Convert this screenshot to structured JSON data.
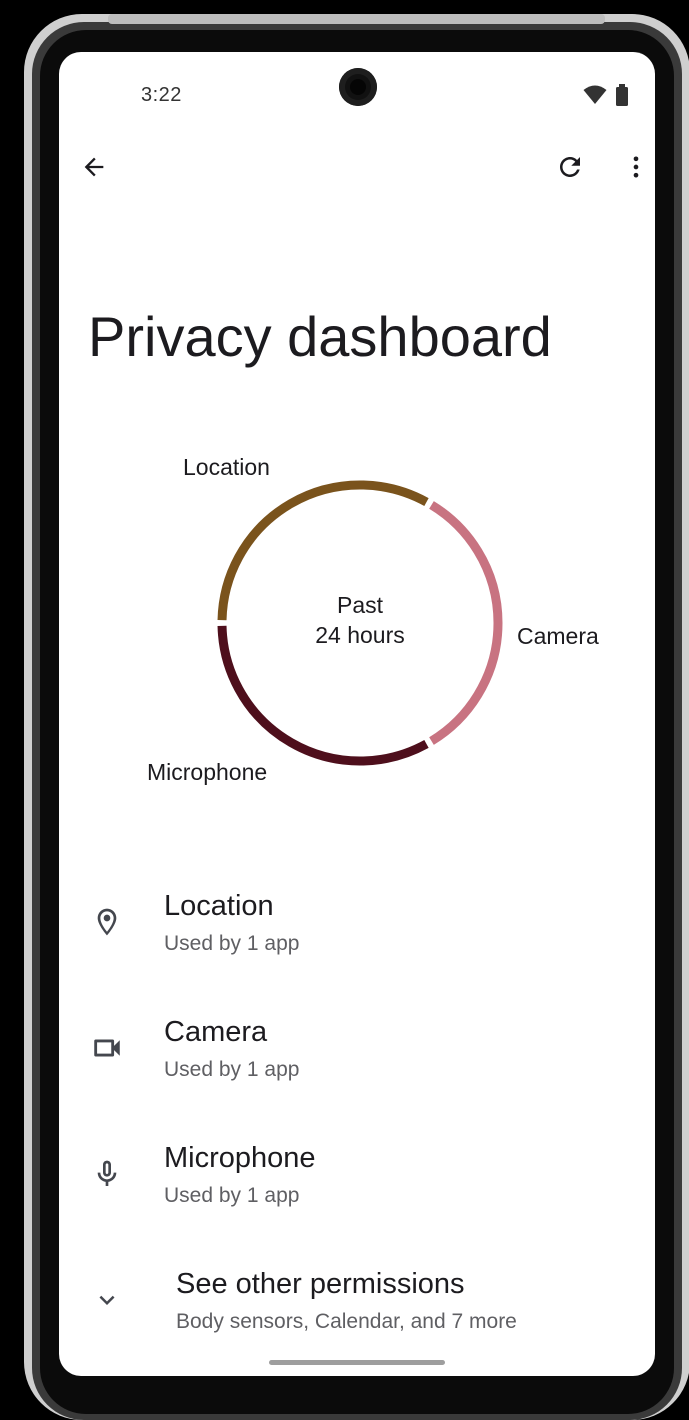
{
  "status_bar": {
    "time": "3:22",
    "icons": [
      "wifi-icon",
      "battery-icon"
    ]
  },
  "app_bar": {
    "back_icon": "arrow-back-icon",
    "refresh_icon": "refresh-icon",
    "more_icon": "more-vert-icon"
  },
  "page": {
    "title": "Privacy dashboard"
  },
  "chart_data": {
    "type": "pie",
    "categories": [
      "Location",
      "Camera",
      "Microphone"
    ],
    "values": [
      1,
      1,
      1
    ],
    "center_text": [
      "Past",
      "24 hours"
    ],
    "colors": [
      "#7a531c",
      "#c87381",
      "#4e0f1c"
    ],
    "legend": "labels around ring"
  },
  "permissions": [
    {
      "title": "Location",
      "subtitle": "Used by 1 app",
      "icon": "location-pin-icon"
    },
    {
      "title": "Camera",
      "subtitle": "Used by 1 app",
      "icon": "videocam-icon"
    },
    {
      "title": "Microphone",
      "subtitle": "Used by 1 app",
      "icon": "microphone-icon"
    }
  ],
  "other_permissions": {
    "title": "See other permissions",
    "subtitle": "Body sensors, Calendar, and 7 more",
    "icon": "chevron-down-icon"
  }
}
